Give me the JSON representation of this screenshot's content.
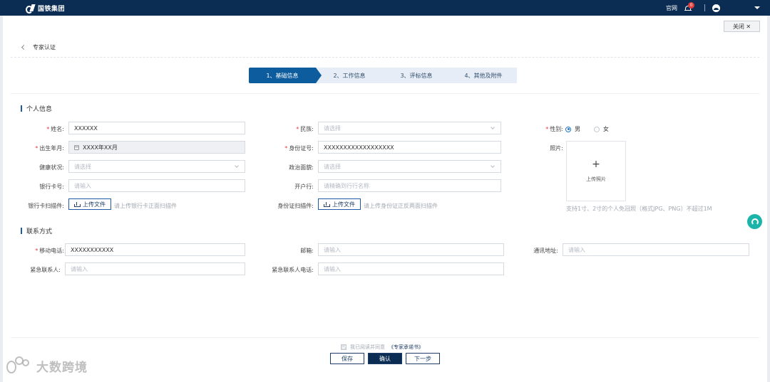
{
  "header": {
    "logo_text": "国铁集团",
    "link_official": "官网",
    "notification_count": "0"
  },
  "toolbar": {
    "close_label": "关闭 ✕"
  },
  "breadcrumb": {
    "title": "专家认证"
  },
  "steps": [
    {
      "label": "1、基础信息",
      "active": true
    },
    {
      "label": "2、工作信息",
      "active": false
    },
    {
      "label": "3、评标信息",
      "active": false
    },
    {
      "label": "4、其他及附件",
      "active": false
    }
  ],
  "personal": {
    "section_title": "个人信息",
    "name": {
      "label": "姓名:",
      "value": "XXXXXX"
    },
    "ethnicity": {
      "label": "民族:",
      "placeholder": "请选择"
    },
    "gender": {
      "label": "性别:",
      "options": [
        "男",
        "女"
      ],
      "selected": "男"
    },
    "birth": {
      "label": "出生年月:",
      "value": "XXXX年XX月"
    },
    "id_number": {
      "label": "身份证号:",
      "value": "XXXXXXXXXXXXXXXXXX"
    },
    "photo": {
      "label": "照片:",
      "upload_label": "上传照片",
      "hint": "支持1寸、2寸的个人免冠照（格式JPG、PNG）不超过1M"
    },
    "health": {
      "label": "健康状况:",
      "placeholder": "请选择"
    },
    "politics": {
      "label": "政治面貌:",
      "placeholder": "请选择"
    },
    "bank_card": {
      "label": "银行卡号:",
      "placeholder": "请输入"
    },
    "bank_branch": {
      "label": "开户行:",
      "placeholder": "请精确到行行名称"
    },
    "bank_scan": {
      "label": "银行卡扫描件:",
      "button": "上传文件",
      "hint": "请上传银行卡正面扫描件"
    },
    "id_scan": {
      "label": "身份证扫描件:",
      "button": "上传文件",
      "hint": "请上传身份证正反两面扫描件"
    }
  },
  "contact": {
    "section_title": "联系方式",
    "mobile": {
      "label": "移动电话:",
      "value": "XXXXXXXXXXX"
    },
    "email": {
      "label": "邮箱:",
      "placeholder": "请输入"
    },
    "address": {
      "label": "通讯地址:",
      "placeholder": "请输入"
    },
    "emergency_name": {
      "label": "紧急联系人:",
      "placeholder": "请输入"
    },
    "emergency_phone": {
      "label": "紧急联系人电话:",
      "placeholder": "请输入"
    }
  },
  "footer": {
    "agree_text": "我已阅读并同意",
    "agree_link": "《专家承诺书》",
    "save": "保存",
    "confirm": "确认",
    "next": "下一步"
  },
  "watermark": {
    "text": "大数跨境"
  },
  "colors": {
    "header": "#0b2c53",
    "step_active": "#0d5c9e",
    "required": "#e23b3b",
    "help": "#1ab5a8"
  }
}
